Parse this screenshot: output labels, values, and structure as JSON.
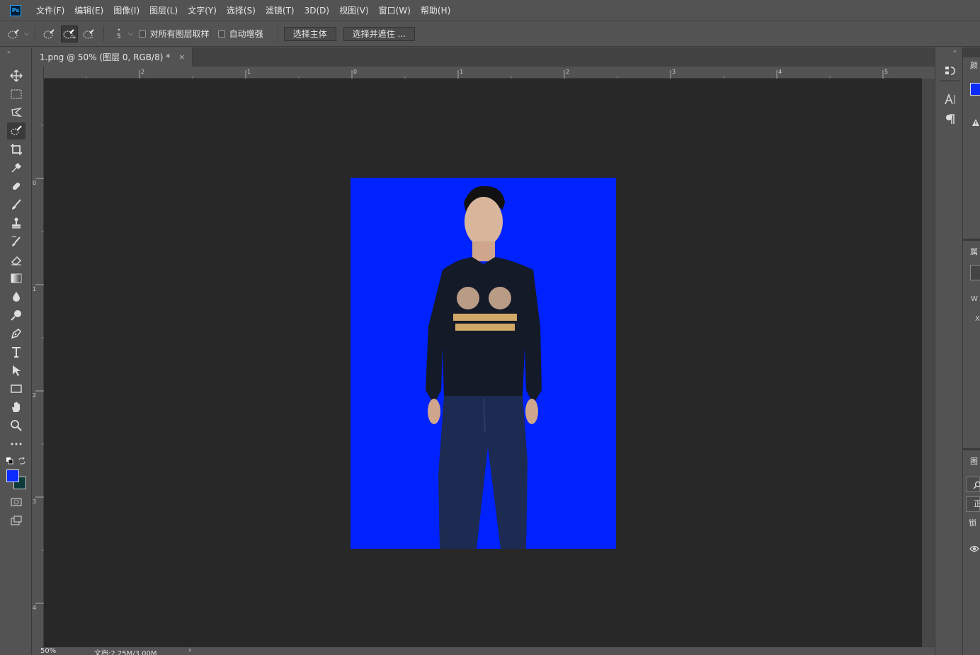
{
  "app": {
    "logo": "Ps"
  },
  "menu": [
    "文件(F)",
    "编辑(E)",
    "图像(I)",
    "图层(L)",
    "文字(Y)",
    "选择(S)",
    "滤镜(T)",
    "3D(D)",
    "视图(V)",
    "窗口(W)",
    "帮助(H)"
  ],
  "options": {
    "brush_size": "5",
    "sample_all_layers": "对所有图层取样",
    "auto_enhance": "自动增强",
    "select_subject": "选择主体",
    "select_and_mask": "选择并遮住 ..."
  },
  "document": {
    "tab_title": "1.png @ 50% (图层 0, RGB/8) *",
    "close_glyph": "×",
    "image_bg_color": "#0022ff"
  },
  "ruler": {
    "h_labels": [
      "2",
      "1",
      "0",
      "1",
      "2",
      "3",
      "4",
      "5"
    ],
    "v_labels": [
      "0",
      "1",
      "2",
      "3",
      "4"
    ]
  },
  "status": {
    "zoom": "50%",
    "doc_size": "文档:2.25M/3.00M",
    "arrow": "›"
  },
  "colors": {
    "foreground": "#0b2bff",
    "background": "#0d3b3b"
  },
  "right_panel": {
    "color_tab": "颜",
    "properties_tab": "属",
    "layers_tab": "图",
    "w_label": "W",
    "x_label": "X",
    "mode_label": "正",
    "lock_label": "锁"
  }
}
